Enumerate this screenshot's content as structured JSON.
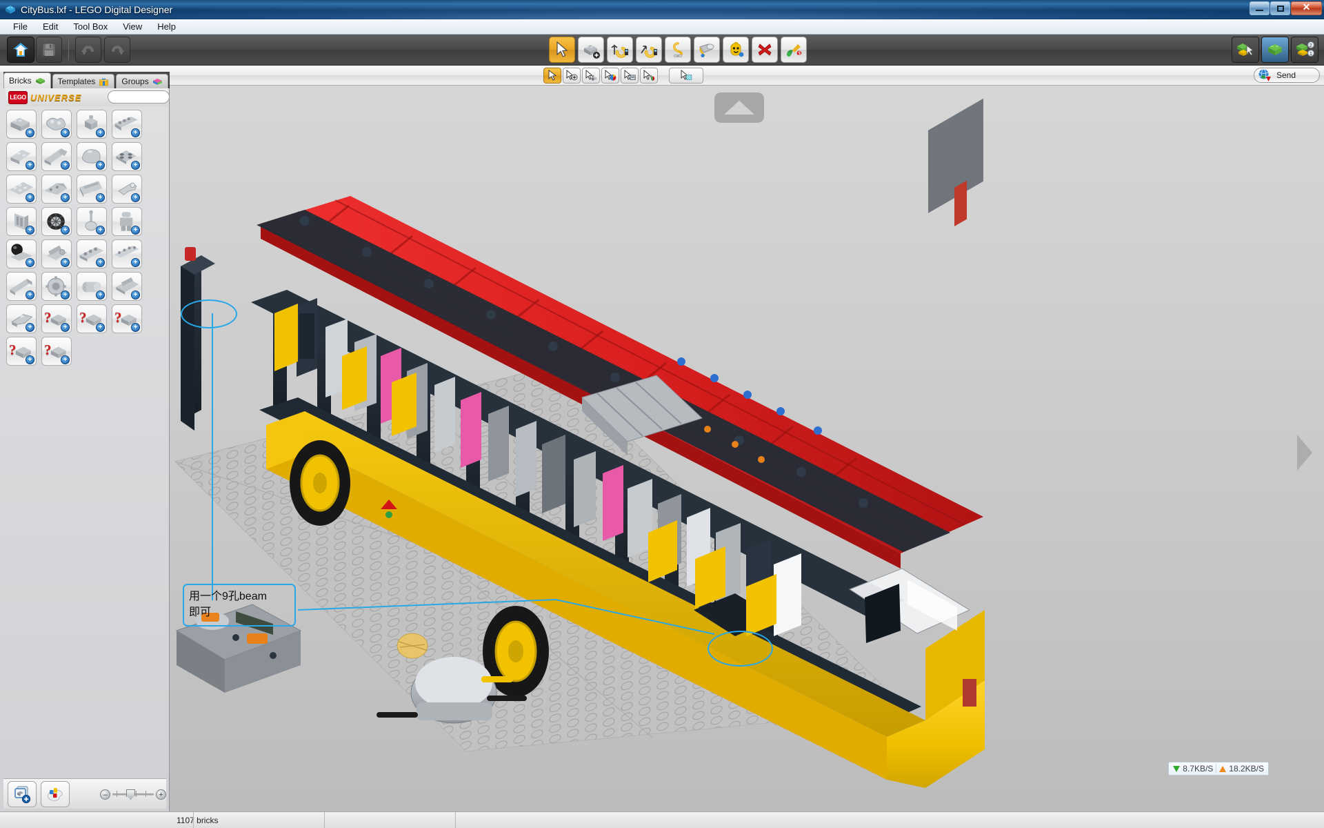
{
  "window": {
    "title": "CityBus.lxf - LEGO Digital Designer",
    "app_icon": "lego-brick-icon",
    "controls": {
      "minimize": "–",
      "maximize": "❐",
      "close": "✕"
    }
  },
  "menu": {
    "items": [
      {
        "label": "File",
        "name": "menu-file"
      },
      {
        "label": "Edit",
        "name": "menu-edit"
      },
      {
        "label": "Tool Box",
        "name": "menu-tool-box"
      },
      {
        "label": "View",
        "name": "menu-view"
      },
      {
        "label": "Help",
        "name": "menu-help"
      }
    ]
  },
  "toolbar": {
    "left_buttons": [
      {
        "name": "home-button",
        "icon": "home-icon",
        "label": "Home"
      },
      {
        "name": "save-button",
        "icon": "floppy-save-icon",
        "label": "Save"
      },
      {
        "name": "undo-button",
        "icon": "undo-arrow-icon",
        "label": "Undo"
      },
      {
        "name": "redo-button",
        "icon": "redo-arrow-icon",
        "label": "Redo"
      }
    ],
    "center_tools": [
      {
        "name": "tool-select",
        "icon": "cursor-arrow-icon",
        "label": "Selection Tool",
        "active": true
      },
      {
        "name": "tool-clone",
        "icon": "clone-brick-icon",
        "label": "Clone Tool",
        "active": false
      },
      {
        "name": "tool-hinge",
        "icon": "hinge-rotate-icon",
        "label": "Hinge Tool",
        "active": false
      },
      {
        "name": "tool-hinge-align",
        "icon": "hinge-align-icon",
        "label": "Hinge Align Tool",
        "active": false
      },
      {
        "name": "tool-flex",
        "icon": "flex-tool-icon",
        "label": "Flex Tool",
        "active": false
      },
      {
        "name": "tool-paint",
        "icon": "paint-bucket-icon",
        "label": "Paint Tool",
        "active": false
      },
      {
        "name": "tool-minifig",
        "icon": "minifig-head-icon",
        "label": "Minifig Tool",
        "active": false
      },
      {
        "name": "tool-delete",
        "icon": "red-x-delete-icon",
        "label": "Delete Tool",
        "active": false
      },
      {
        "name": "tool-decorate",
        "icon": "decoration-icon",
        "label": "Decoration Tool",
        "active": false
      }
    ],
    "right_modes": [
      {
        "name": "mode-build",
        "icon": "green-brick-cursor-icon",
        "label": "Build Mode",
        "active": false
      },
      {
        "name": "mode-view",
        "icon": "brick-photo-icon",
        "label": "View Mode",
        "active": true
      },
      {
        "name": "mode-building-guide",
        "icon": "brick-steps-icon",
        "label": "Building Guide Mode",
        "active": false
      }
    ]
  },
  "subtoolbar": {
    "tools": [
      {
        "name": "subtool-select-single",
        "icon": "cursor-single-icon",
        "label": "Select Single",
        "active": true
      },
      {
        "name": "subtool-select-connected",
        "icon": "cursor-plus-icon",
        "label": "Select Connected",
        "active": false
      },
      {
        "name": "subtool-select-brick-type",
        "icon": "cursor-bricks-icon",
        "label": "Select By Brick Type",
        "active": false
      },
      {
        "name": "subtool-select-color",
        "icon": "cursor-color-icon",
        "label": "Select By Color",
        "active": false
      },
      {
        "name": "subtool-select-template",
        "icon": "cursor-template-icon",
        "label": "Select Template",
        "active": false
      },
      {
        "name": "subtool-select-color-type",
        "icon": "cursor-color-type-icon",
        "label": "Select By Color And Type",
        "active": false
      },
      {
        "name": "subtool-select-all",
        "icon": "cursor-select-all-icon",
        "label": "Select All",
        "active": false
      }
    ],
    "send": {
      "label": "Send",
      "icon": "globe-send-icon",
      "name": "send-button"
    }
  },
  "left_panel": {
    "tabs": [
      {
        "label": "Bricks",
        "icon": "green-brick-icon",
        "name": "tab-bricks",
        "active": true
      },
      {
        "label": "Templates",
        "icon": "gift-box-icon",
        "name": "tab-templates",
        "active": false
      },
      {
        "label": "Groups",
        "icon": "color-brick-icon",
        "name": "tab-groups",
        "active": false
      }
    ],
    "theme": {
      "brand": "LEGO",
      "name": "UNIVERSE",
      "logo_color": "#d0021b",
      "text_color": "#e8a317"
    },
    "search": {
      "placeholder": "",
      "value": "",
      "name": "brick-search-input"
    },
    "brick_palette": [
      {
        "id": 1,
        "icon": "brick-2x4-icon",
        "badge": "+",
        "question": false
      },
      {
        "id": 2,
        "icon": "brick-plate-round-icon",
        "badge": "+",
        "question": false
      },
      {
        "id": 3,
        "icon": "brick-1x1-stud-icon",
        "badge": "+",
        "question": false
      },
      {
        "id": 4,
        "icon": "technic-brick-holes-icon",
        "badge": "+",
        "question": false
      },
      {
        "id": 5,
        "icon": "slope-brick-icon",
        "badge": "+",
        "question": false
      },
      {
        "id": 6,
        "icon": "long-slope-icon",
        "badge": "+",
        "question": false
      },
      {
        "id": 7,
        "icon": "curved-brick-icon",
        "badge": "+",
        "question": false
      },
      {
        "id": 8,
        "icon": "plate-2x2-icon",
        "badge": "+",
        "question": false
      },
      {
        "id": 9,
        "icon": "plate-round-cluster-icon",
        "badge": "+",
        "question": false
      },
      {
        "id": 10,
        "icon": "wedge-plate-icon",
        "badge": "+",
        "question": false
      },
      {
        "id": 11,
        "icon": "panel-brick-icon",
        "badge": "+",
        "question": false
      },
      {
        "id": 12,
        "icon": "clip-plate-icon",
        "badge": "+",
        "question": false
      },
      {
        "id": 13,
        "icon": "door-panel-icon",
        "badge": "+",
        "question": false
      },
      {
        "id": 14,
        "icon": "tire-wheel-icon",
        "badge": "+",
        "question": false
      },
      {
        "id": 15,
        "icon": "antenna-lever-icon",
        "badge": "+",
        "question": false
      },
      {
        "id": 16,
        "icon": "minifig-body-icon",
        "badge": "+",
        "question": false
      },
      {
        "id": 17,
        "icon": "sphere-ball-icon",
        "badge": "+",
        "question": false
      },
      {
        "id": 18,
        "icon": "motor-cylinder-icon",
        "badge": "+",
        "question": false
      },
      {
        "id": 19,
        "icon": "technic-beam-icon",
        "badge": "+",
        "question": false
      },
      {
        "id": 20,
        "icon": "technic-liftarm-icon",
        "badge": "+",
        "question": false
      },
      {
        "id": 21,
        "icon": "technic-axle-icon",
        "badge": "+",
        "question": false
      },
      {
        "id": 22,
        "icon": "technic-gear-icon",
        "badge": "+",
        "question": false
      },
      {
        "id": 23,
        "icon": "technic-tube-icon",
        "badge": "+",
        "question": false
      },
      {
        "id": 24,
        "icon": "technic-panel-icon",
        "badge": "+",
        "question": false
      },
      {
        "id": 25,
        "icon": "technic-connector-icon",
        "badge": "+",
        "question": false
      },
      {
        "id": 26,
        "icon": "unknown-brick-icon",
        "badge": "+",
        "question": true
      },
      {
        "id": 27,
        "icon": "unknown-brick-icon",
        "badge": "+",
        "question": true
      },
      {
        "id": 28,
        "icon": "unknown-brick-icon",
        "badge": "+",
        "question": true
      },
      {
        "id": 29,
        "icon": "unknown-brick-icon",
        "badge": "+",
        "question": true
      },
      {
        "id": 30,
        "icon": "unknown-brick-icon",
        "badge": "+",
        "question": true
      }
    ],
    "bottom_controls": [
      {
        "name": "brick-palette-stack-button",
        "icon": "brick-stack-plus-icon",
        "label": "Brick Palette"
      },
      {
        "name": "color-palette-button",
        "icon": "color-bricks-icon",
        "label": "Color Palette"
      }
    ],
    "zoom_slider": {
      "name": "palette-zoom-slider",
      "minus_label": "–",
      "plus_label": "+",
      "value": 50,
      "min": 0,
      "max": 100
    }
  },
  "viewport": {
    "name": "model-viewport",
    "nav_up": {
      "name": "nav-rotate-up-button",
      "icon": "triangle-up-icon"
    },
    "nav_right": {
      "name": "nav-rotate-right-button",
      "icon": "triangle-right-icon"
    },
    "model": {
      "name": "citybus-lego-model",
      "colors": {
        "body": "#f2c200",
        "roof": "#d81e1e",
        "frame": "#1f2833",
        "gray": "#9aa0a6",
        "wheel_hub": "#f2c200",
        "tire": "#1a1a1a",
        "pink": "#e85aa8",
        "blue": "#2f6fd0",
        "orange": "#e8811a"
      }
    },
    "annotation": {
      "name": "callout-annotation",
      "color": "#28a8e8",
      "line1": "用一个9孔beam",
      "line2": "即可"
    },
    "highlight_ellipses": [
      {
        "name": "highlight-ellipse-roof-beam"
      },
      {
        "name": "highlight-ellipse-body-beam"
      }
    ],
    "network": {
      "name": "network-speed-indicator",
      "download_icon": "arrow-down-icon",
      "download": "8.7KB/S",
      "upload_icon": "arrow-up-icon",
      "upload": "18.2KB/S",
      "download_color": "#2faa2f",
      "upload_color": "#f08a1a"
    }
  },
  "statusbar": {
    "name": "status-bar",
    "brick_count": "1107 bricks"
  }
}
